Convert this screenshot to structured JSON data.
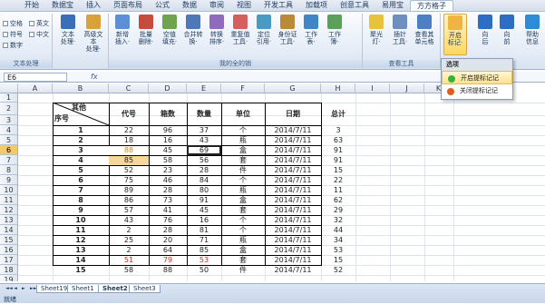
{
  "tabs": [
    "开始",
    "数据宝",
    "插入",
    "页面布局",
    "公式",
    "数据",
    "审阅",
    "视图",
    "开发工具",
    "加载项",
    "创意工具",
    "易用宝",
    "方方格子"
  ],
  "active_tab": "方方格子",
  "ribbon": {
    "checks": [
      "空格",
      "英文",
      "符号",
      "中文",
      "数字"
    ],
    "group1_label": "文本处理",
    "buttons": [
      {
        "label": "文本\n处理·",
        "icon": "text-process-icon",
        "color": "#3a6fb8"
      },
      {
        "label": "高级文本\n处理·",
        "icon": "advanced-text-icon",
        "color": "#d9a13a"
      },
      {
        "label": "新增\n插入·",
        "icon": "insert-icon",
        "color": "#5c8fd6"
      },
      {
        "label": "批量\n删除·",
        "icon": "batch-delete-icon",
        "color": "#c64b3c"
      },
      {
        "label": "空值\n填充·",
        "icon": "fill-icon",
        "color": "#6fa34e"
      },
      {
        "label": "合并转\n换·",
        "icon": "merge-icon",
        "color": "#4f78b8"
      },
      {
        "label": "转换\n排序·",
        "icon": "sort-icon",
        "color": "#8f6bbd"
      },
      {
        "label": "重复值\n工具·",
        "icon": "duplicate-icon",
        "color": "#d55f5f"
      },
      {
        "label": "定位\n引用·",
        "icon": "locate-icon",
        "color": "#4a9ac4"
      },
      {
        "label": "身份证\n工具·",
        "icon": "id-card-icon",
        "color": "#b88a3a"
      },
      {
        "label": "工作\n表·",
        "icon": "worksheet-icon",
        "color": "#3e86c6"
      },
      {
        "label": "工作\n簿·",
        "icon": "workbook-icon",
        "color": "#5aa05a"
      },
      {
        "label": "聚光\n灯·",
        "icon": "spotlight-icon",
        "color": "#e7c23b"
      },
      {
        "label": "插针\n工具·",
        "icon": "pin-icon",
        "color": "#6c8fbf"
      },
      {
        "label": "查看其\n单元格",
        "icon": "view-cell-icon",
        "color": "#4d7fc2"
      },
      {
        "label": "开启\n标记·",
        "icon": "mark-icon",
        "color": "#f0b440"
      },
      {
        "label": "向\n后",
        "icon": "back-icon",
        "color": "#2e6dc4"
      },
      {
        "label": "向\n前",
        "icon": "forward-icon",
        "color": "#2e6dc4"
      },
      {
        "label": "帮助\n信息",
        "icon": "help-icon",
        "color": "#2e8bd6"
      }
    ],
    "group2_label": "我的全的销",
    "group3_label": "查看工具"
  },
  "namebox": "E6",
  "fx": "fx",
  "columns": [
    "A",
    "B",
    "C",
    "D",
    "E",
    "F",
    "G",
    "H",
    "I",
    "J",
    "K"
  ],
  "rows": [
    "1",
    "2",
    "3",
    "4",
    "5",
    "6",
    "7",
    "8",
    "9",
    "10",
    "11",
    "12",
    "13",
    "14",
    "15",
    "16",
    "17",
    "18",
    "19"
  ],
  "selected_row": "6",
  "table": {
    "header_diag_top": "其他",
    "header_diag_bottom": "序号",
    "headers": [
      "代号",
      "箱数",
      "数量",
      "单位",
      "日期",
      "总计"
    ],
    "rows": [
      [
        "1",
        "22",
        "96",
        "37",
        "个",
        "2014/7/11",
        "3"
      ],
      [
        "2",
        "18",
        "16",
        "43",
        "瓶",
        "2014/7/11",
        "63"
      ],
      [
        "3",
        "88",
        "45",
        "69",
        "盒",
        "2014/7/11",
        "91"
      ],
      [
        "4",
        "85",
        "58",
        "56",
        "套",
        "2014/7/11",
        "91"
      ],
      [
        "5",
        "52",
        "23",
        "28",
        "件",
        "2014/7/11",
        "15"
      ],
      [
        "6",
        "75",
        "46",
        "84",
        "个",
        "2014/7/11",
        "22"
      ],
      [
        "7",
        "89",
        "28",
        "80",
        "瓶",
        "2014/7/11",
        "11"
      ],
      [
        "8",
        "86",
        "73",
        "91",
        "盒",
        "2014/7/11",
        "62"
      ],
      [
        "9",
        "57",
        "41",
        "45",
        "套",
        "2014/7/11",
        "29"
      ],
      [
        "10",
        "43",
        "76",
        "16",
        "个",
        "2014/7/11",
        "32"
      ],
      [
        "11",
        "2",
        "28",
        "81",
        "个",
        "2014/7/11",
        "44"
      ],
      [
        "12",
        "25",
        "20",
        "71",
        "瓶",
        "2014/7/11",
        "34"
      ],
      [
        "13",
        "2",
        "64",
        "85",
        "盒",
        "2014/7/11",
        "53"
      ],
      [
        "14",
        "51",
        "79",
        "53",
        "套",
        "2014/7/11",
        "15"
      ],
      [
        "15",
        "58",
        "88",
        "50",
        "件",
        "2014/7/11",
        "52"
      ]
    ],
    "red_row": "14",
    "orange_cell_row": "3"
  },
  "sheet_tabs": [
    "Sheet19",
    "Sheet1",
    "Sheet2",
    "Sheet3"
  ],
  "active_sheet": "Sheet2",
  "status": "就绪",
  "dropdown": {
    "header": "选项",
    "items": [
      {
        "label": "开启提标记记",
        "dot": "#35b23a"
      },
      {
        "label": "关闭提标记记",
        "dot": "#e35b1e"
      }
    ]
  }
}
